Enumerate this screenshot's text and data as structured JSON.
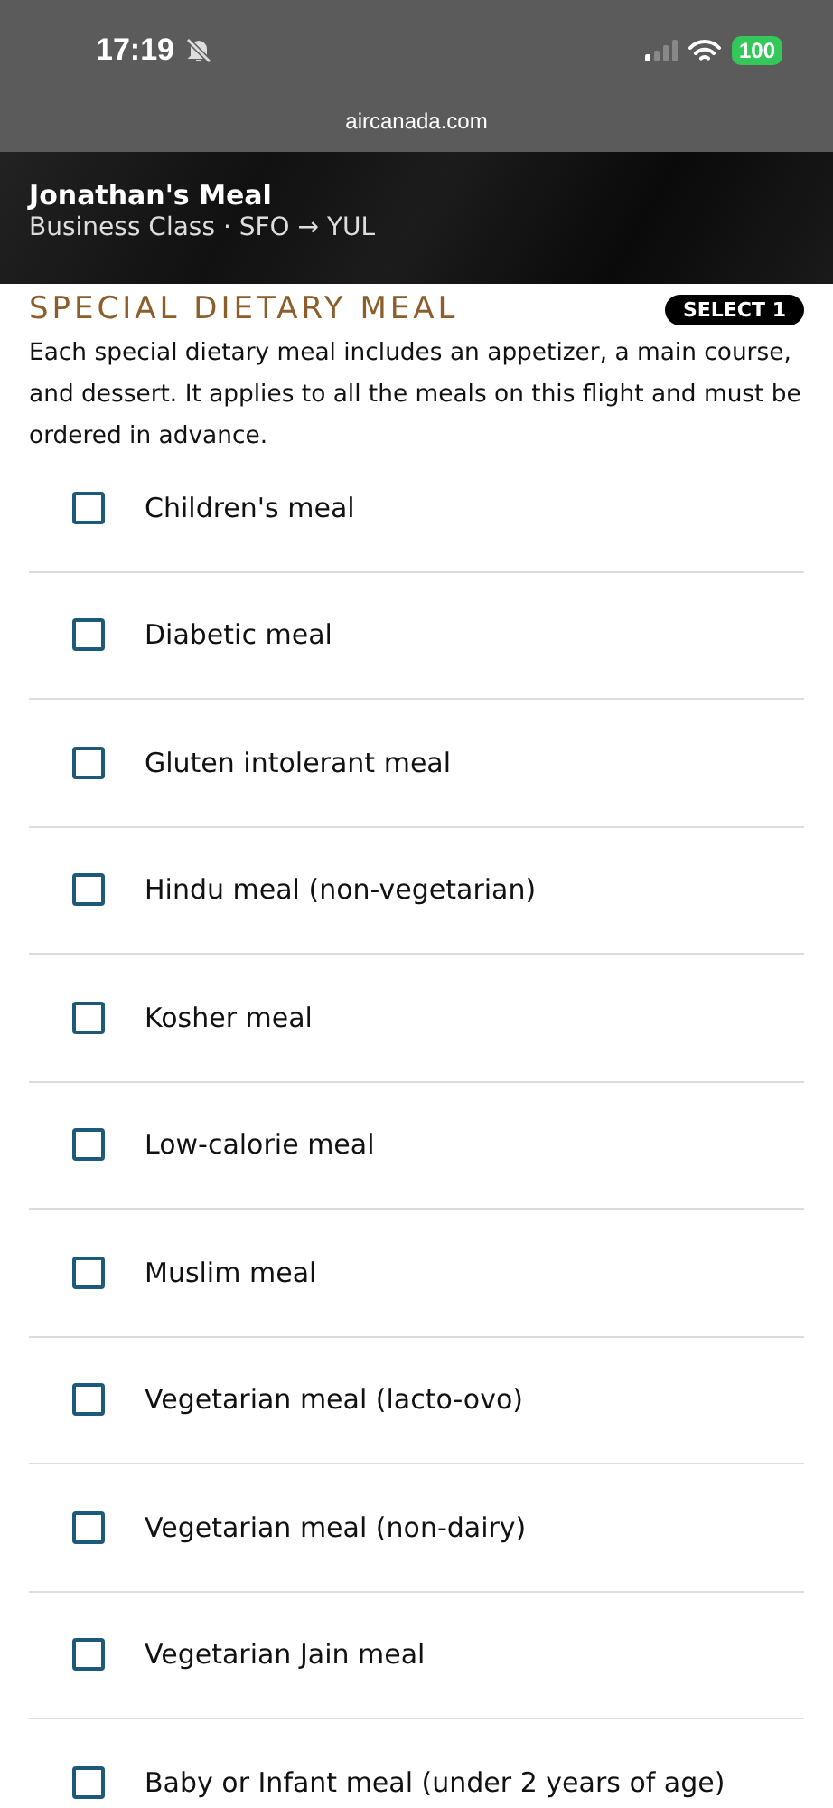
{
  "status_bar": {
    "time": "17:19",
    "battery": "100"
  },
  "url_bar": {
    "address": "aircanada.com"
  },
  "header": {
    "title": "Jonathan's Meal",
    "subtitle": "Business Class · SFO → YUL"
  },
  "section": {
    "title": "SPECIAL DIETARY MEAL",
    "badge": "SELECT 1",
    "description": "Each special dietary meal includes an appetizer, a main course, and dessert. It applies to all the meals on this flight and must be ordered in advance."
  },
  "options": [
    {
      "label": "Children's meal",
      "checked": false
    },
    {
      "label": "Diabetic meal",
      "checked": false
    },
    {
      "label": "Gluten intolerant meal",
      "checked": false
    },
    {
      "label": "Hindu meal (non-vegetarian)",
      "checked": false
    },
    {
      "label": "Kosher meal",
      "checked": false
    },
    {
      "label": "Low-calorie meal",
      "checked": false
    },
    {
      "label": "Muslim meal",
      "checked": false
    },
    {
      "label": "Vegetarian meal (lacto-ovo)",
      "checked": false
    },
    {
      "label": "Vegetarian meal (non-dairy)",
      "checked": false
    },
    {
      "label": "Vegetarian Jain meal",
      "checked": false
    },
    {
      "label": "Baby or Infant meal (under 2 years of age)",
      "checked": false
    }
  ]
}
